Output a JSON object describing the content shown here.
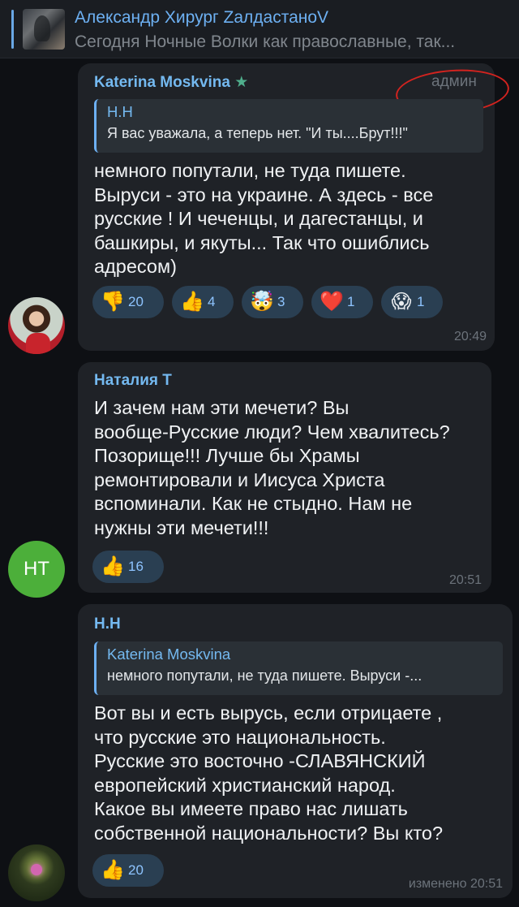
{
  "pinned": {
    "title": "Александр Хирург ZалдастаноV",
    "text": "Сегодня Ночные Волки как православные, так..."
  },
  "messages": [
    {
      "author": "Katerina Moskvina",
      "author_badge": "★",
      "role": "админ",
      "reply": {
        "author": "Н.Н",
        "text": "Я вас уважала, а теперь нет. \"И ты....Брут!!!\""
      },
      "text": "немного попутали, не туда пишете.\nВыруси - это на украине. А здесь - все\nрусские ! И чеченцы, и дагестанцы, и\nбашкиры, и якуты... Так что ошиблись\nадресом)",
      "reactions": [
        {
          "emoji": "thumbs-down",
          "glyph": "👎",
          "count": "20"
        },
        {
          "emoji": "thumbs-up",
          "glyph": "👍",
          "count": "4"
        },
        {
          "emoji": "exploding-head",
          "glyph": "🤯",
          "count": "3"
        },
        {
          "emoji": "heart",
          "glyph": "❤️",
          "count": "1"
        },
        {
          "emoji": "screaming-face",
          "glyph": "😱",
          "count": "1"
        }
      ],
      "time": "20:49"
    },
    {
      "author": "Наталия Т",
      "avatar_initials": "НТ",
      "text": "И зачем нам эти мечети? Вы\nвообще-Русские люди? Чем хвалитесь?\nПозорище!!! Лучше бы Храмы\nремонтировали и Иисуса Христа\nвспоминали. Как не стыдно. Нам не\nнужны эти мечети!!!",
      "reactions": [
        {
          "emoji": "thumbs-up",
          "glyph": "👍",
          "count": "16"
        }
      ],
      "time": "20:51"
    },
    {
      "author": "Н.Н",
      "reply": {
        "author": "Katerina Moskvina",
        "text": "немного попутали, не туда пишете. Выруси -..."
      },
      "text": "Вот вы и есть вырусь, если отрицаете ,\nчто русские это  национальность.\nРусские это восточно -СЛАВЯНСКИЙ\nевропейский христианский народ.\nКакое вы имеете право нас лишать\nсобственной национальности? Вы кто?",
      "reactions": [
        {
          "emoji": "thumbs-up",
          "glyph": "👍",
          "count": "20"
        }
      ],
      "time": "изменено 20:51"
    }
  ],
  "colors": {
    "background": "#0e1014",
    "bubble": "#1f2227",
    "accent": "#6db0f2",
    "reaction_bg": "#2a3f52",
    "admin_circle": "#d2231f",
    "avatar_green": "#4caf3a"
  }
}
